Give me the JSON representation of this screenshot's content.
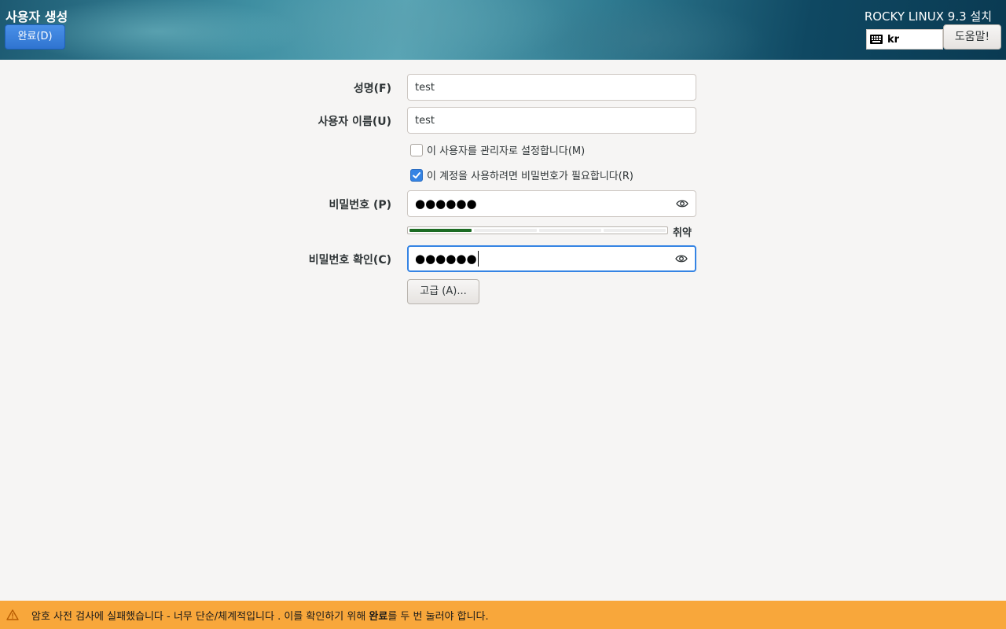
{
  "header": {
    "screen_title": "사용자 생성",
    "done_label": "완료(D)",
    "product_title": "ROCKY LINUX 9.3 설치",
    "keyboard_layout": "kr",
    "help_label": "도움말!"
  },
  "form": {
    "fullname_label": "성명(F)",
    "fullname_value": "test",
    "username_label": "사용자 이름(U)",
    "username_value": "test",
    "admin_checkbox_label": "이 사용자를 관리자로 설정합니다(M)",
    "admin_checked": false,
    "require_password_label": "이 계정을 사용하려면 비밀번호가 필요합니다(R)",
    "require_password_checked": true,
    "password_label": "비밀번호 (P)",
    "password_value": "●●●●●●",
    "strength_text": "취약",
    "strength_fraction": 0.25,
    "confirm_label": "비밀번호 확인(C)",
    "confirm_value": "●●●●●●",
    "advanced_label": "고급 (A)..."
  },
  "warning": {
    "message_before": "암호 사전 검사에 실패했습니다 - 너무 단순/체계적입니다  . 이를 확인하기 위해 ",
    "message_bold": "완료",
    "message_after": "를 두 번 눌러야 합니다."
  },
  "colors": {
    "accent": "#3584e4",
    "warning_bg": "#f8a73b",
    "strength_weak": "#1c6b23"
  }
}
